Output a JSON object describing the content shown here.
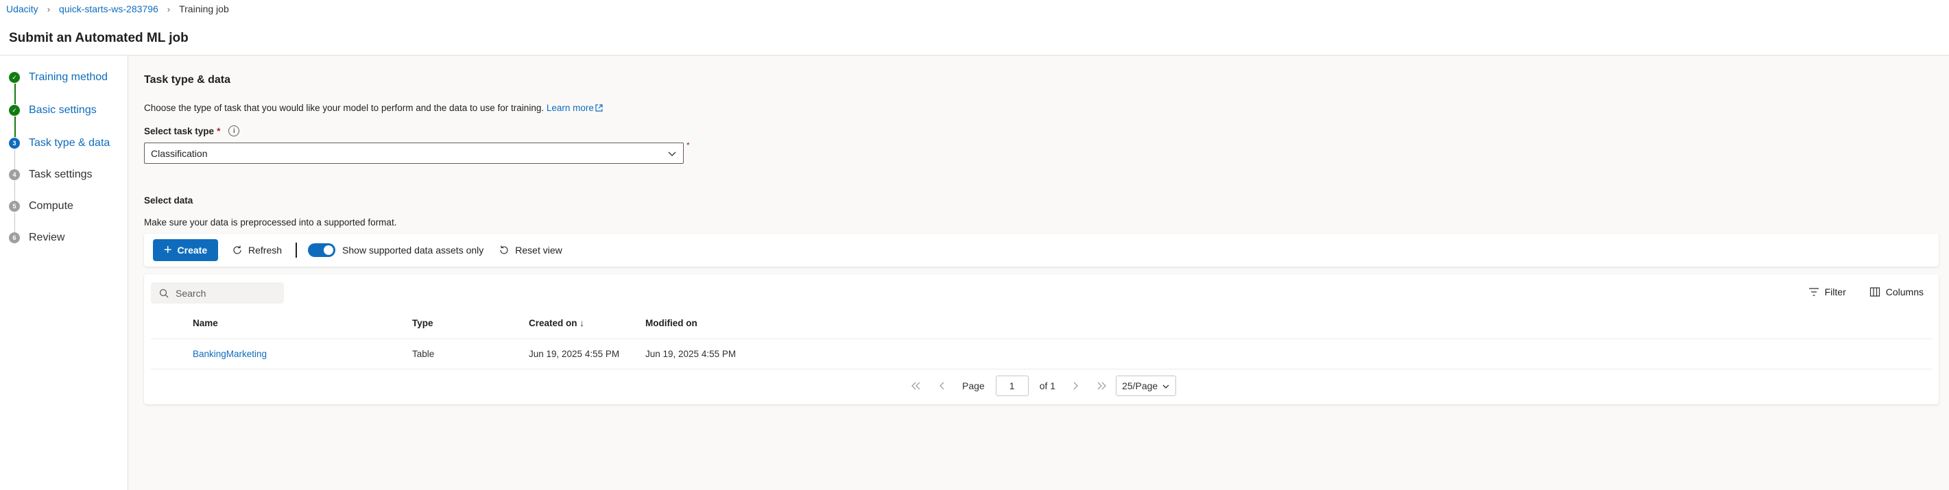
{
  "breadcrumb": {
    "workspace_org": "Udacity",
    "workspace": "quick-starts-ws-283796",
    "current": "Training job"
  },
  "page": {
    "title": "Submit an Automated ML job"
  },
  "steps": [
    {
      "label": "Training method",
      "number": "1",
      "state": "done"
    },
    {
      "label": "Basic settings",
      "number": "2",
      "state": "done"
    },
    {
      "label": "Task type & data",
      "number": "3",
      "state": "active"
    },
    {
      "label": "Task settings",
      "number": "4",
      "state": "pending"
    },
    {
      "label": "Compute",
      "number": "5",
      "state": "pending"
    },
    {
      "label": "Review",
      "number": "6",
      "state": "pending"
    }
  ],
  "main": {
    "section_title": "Task type & data",
    "description": "Choose the type of task that you would like your model to perform and the data to use for training.",
    "learn_more": "Learn more",
    "task_type_label": "Select task type",
    "required_mark": "*",
    "task_type_value": "Classification",
    "select_data_title": "Select data",
    "select_data_desc": "Make sure your data is preprocessed into a supported format."
  },
  "toolbar": {
    "create_label": "Create",
    "refresh_label": "Refresh",
    "toggle_label": "Show supported data assets only",
    "toggle_on": true,
    "reset_label": "Reset view"
  },
  "grid": {
    "search_placeholder": "Search",
    "filter_label": "Filter",
    "columns_label": "Columns",
    "headers": [
      "Name",
      "Type",
      "Created on ↓",
      "Modified on"
    ],
    "rows": [
      {
        "name": "BankingMarketing",
        "type": "Table",
        "created": "Jun 19, 2025 4:55 PM",
        "modified": "Jun 19, 2025 4:55 PM"
      }
    ]
  },
  "pager": {
    "page_label": "Page",
    "page_value": "1",
    "of_label": "of 1",
    "page_size": "25/Page"
  },
  "colors": {
    "accent": "#0f6cbd",
    "success": "#107c10",
    "required": "#a4262c"
  }
}
